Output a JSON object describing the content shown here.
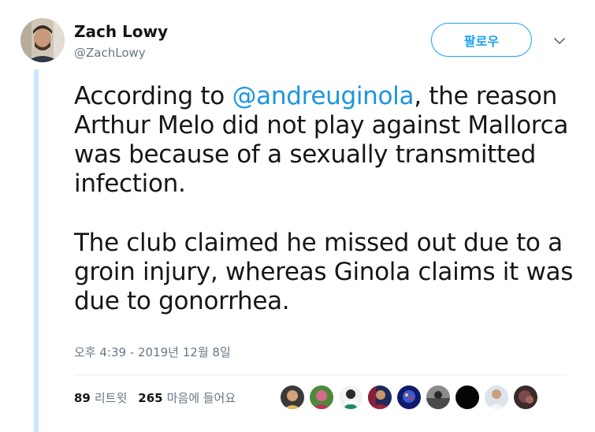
{
  "author": {
    "name": "Zach Lowy",
    "handle": "@ZachLowy"
  },
  "follow_button": {
    "label": "팔로우"
  },
  "tweet": {
    "paragraph1": {
      "prefix": "According to ",
      "mention": "@andreuginola",
      "suffix": ", the reason Arthur Melo did not play against Mallorca was because of a sexually transmitted infection."
    },
    "paragraph2": "The club claimed he missed out due to a groin injury, whereas Ginola claims it was due to gonorrhea.",
    "timestamp": "오후 4:39 - 2019년 12월 8일"
  },
  "stats": {
    "retweets_count": "89",
    "retweets_label": "리트윗",
    "likes_count": "265",
    "likes_label": "마음에 들어요"
  },
  "colors": {
    "accent": "#1da1f2",
    "mention": "#1b95e0",
    "secondary_text": "#657786",
    "thread_line": "#cce7fb"
  },
  "liker_avatars": [
    "avatar-1",
    "avatar-2",
    "avatar-3",
    "avatar-4",
    "avatar-5",
    "avatar-6",
    "avatar-7",
    "avatar-8",
    "avatar-9"
  ]
}
